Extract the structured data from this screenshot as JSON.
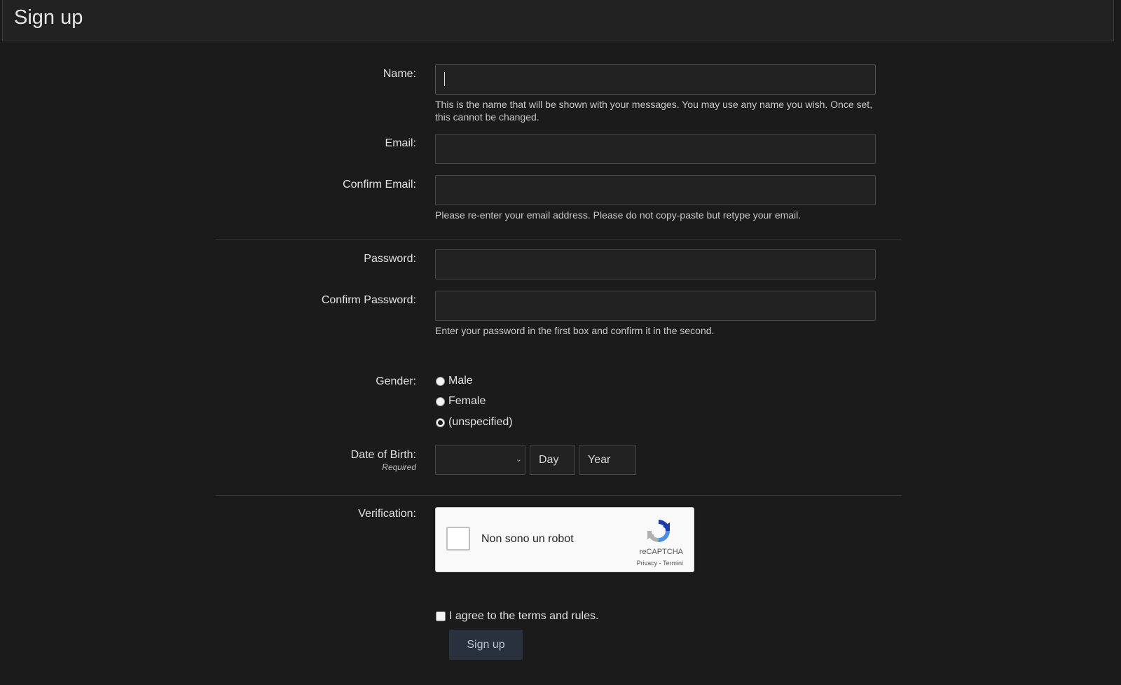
{
  "page": {
    "title": "Sign up"
  },
  "fields": {
    "name": {
      "label": "Name:",
      "value": "",
      "hint": "This is the name that will be shown with your messages. You may use any name you wish. Once set, this cannot be changed."
    },
    "email": {
      "label": "Email:",
      "value": ""
    },
    "confirm_email": {
      "label": "Confirm Email:",
      "value": "",
      "hint": "Please re-enter your email address. Please do not copy-paste but retype your email."
    },
    "password": {
      "label": "Password:",
      "value": ""
    },
    "confirm_password": {
      "label": "Confirm Password:",
      "value": "",
      "hint": "Enter your password in the first box and confirm it in the second."
    }
  },
  "gender": {
    "label": "Gender:",
    "options": [
      "Male",
      "Female",
      "(unspecified)"
    ],
    "selected": "(unspecified)"
  },
  "dob": {
    "label": "Date of Birth:",
    "sublabel": "Required",
    "month_value": "",
    "day_placeholder": "Day",
    "year_placeholder": "Year"
  },
  "verification": {
    "label": "Verification:",
    "checkbox_text": "Non sono un robot",
    "brand": "reCAPTCHA",
    "links": "Privacy - Termini"
  },
  "terms": {
    "label": "I agree to the terms and rules.",
    "checked": false
  },
  "submit": {
    "label": "Sign up"
  },
  "colors": {
    "background": "#1b1b1b",
    "panel": "#222222",
    "input_border": "#484848",
    "button_bg": "#28313d",
    "button_text": "#b8c3d0"
  }
}
